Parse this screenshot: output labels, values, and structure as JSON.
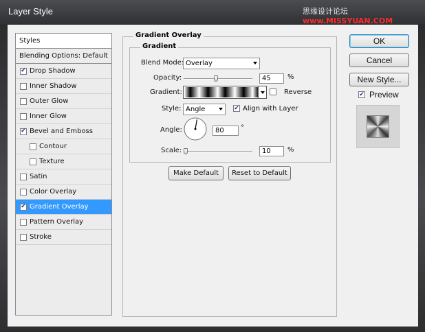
{
  "window": {
    "title": "Layer Style"
  },
  "watermark": {
    "text": "思缘设计论坛 ",
    "site": "www.MISSYUAN.COM"
  },
  "styles_list": [
    {
      "label": "Styles",
      "checkbox": false,
      "checked": false,
      "indent": false,
      "selected": false
    },
    {
      "label": "Blending Options: Default",
      "checkbox": false,
      "checked": false,
      "indent": false,
      "selected": false
    },
    {
      "label": "Drop Shadow",
      "checkbox": true,
      "checked": true,
      "indent": false,
      "selected": false
    },
    {
      "label": "Inner Shadow",
      "checkbox": true,
      "checked": false,
      "indent": false,
      "selected": false
    },
    {
      "label": "Outer Glow",
      "checkbox": true,
      "checked": false,
      "indent": false,
      "selected": false
    },
    {
      "label": "Inner Glow",
      "checkbox": true,
      "checked": false,
      "indent": false,
      "selected": false
    },
    {
      "label": "Bevel and Emboss",
      "checkbox": true,
      "checked": true,
      "indent": false,
      "selected": false
    },
    {
      "label": "Contour",
      "checkbox": true,
      "checked": false,
      "indent": true,
      "selected": false
    },
    {
      "label": "Texture",
      "checkbox": true,
      "checked": false,
      "indent": true,
      "selected": false
    },
    {
      "label": "Satin",
      "checkbox": true,
      "checked": false,
      "indent": false,
      "selected": false
    },
    {
      "label": "Color Overlay",
      "checkbox": true,
      "checked": false,
      "indent": false,
      "selected": false
    },
    {
      "label": "Gradient Overlay",
      "checkbox": true,
      "checked": true,
      "indent": false,
      "selected": true
    },
    {
      "label": "Pattern Overlay",
      "checkbox": true,
      "checked": false,
      "indent": false,
      "selected": false
    },
    {
      "label": "Stroke",
      "checkbox": true,
      "checked": false,
      "indent": false,
      "selected": false
    }
  ],
  "panel": {
    "title": "Gradient Overlay",
    "subtitle": "Gradient",
    "blend_mode": {
      "label": "Blend Mode:",
      "value": "Overlay"
    },
    "opacity": {
      "label": "Opacity:",
      "value": "45",
      "unit": "%"
    },
    "gradient": {
      "label": "Gradient:",
      "reverse_label": "Reverse",
      "reverse_checked": false
    },
    "style": {
      "label": "Style:",
      "value": "Angle",
      "align_label": "Align with Layer",
      "align_checked": true
    },
    "angle": {
      "label": "Angle:",
      "value": "80",
      "unit": "°"
    },
    "scale": {
      "label": "Scale:",
      "value": "10",
      "unit": "%"
    },
    "make_default": "Make Default",
    "reset_default": "Reset to Default"
  },
  "right": {
    "ok": "OK",
    "cancel": "Cancel",
    "new_style": "New Style...",
    "preview_label": "Preview",
    "preview_checked": true
  },
  "icons": {
    "check": "check-icon",
    "dropdown": "chevron-down-icon",
    "angle_dial": "angle-dial-icon"
  }
}
